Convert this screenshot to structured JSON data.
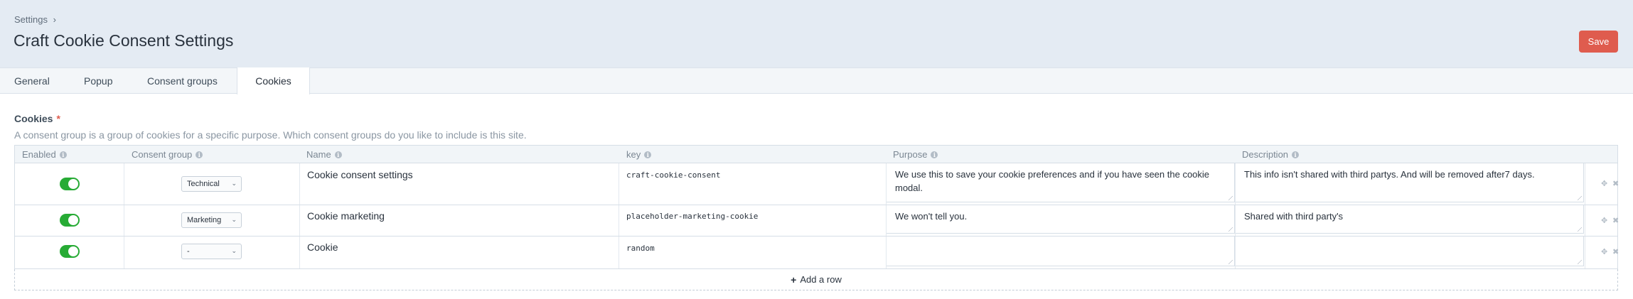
{
  "breadcrumb": {
    "label": "Settings",
    "separator": "›"
  },
  "page": {
    "title": "Craft Cookie Consent Settings",
    "save_label": "Save"
  },
  "tabs": [
    {
      "label": "General",
      "active": false
    },
    {
      "label": "Popup",
      "active": false
    },
    {
      "label": "Consent groups",
      "active": false
    },
    {
      "label": "Cookies",
      "active": true
    }
  ],
  "field": {
    "label": "Cookies",
    "required_mark": "*",
    "instructions": "A consent group is a group of cookies for a specific purpose. Which consent groups do you like to include is this site."
  },
  "table": {
    "columns": [
      "Enabled",
      "Consent group",
      "Name",
      "key",
      "Purpose",
      "Description"
    ],
    "info_glyph": "i",
    "rows": [
      {
        "enabled": true,
        "consent_group": "Technical",
        "name": "Cookie consent settings",
        "key": "craft-cookie-consent",
        "purpose": "We use this to save your cookie preferences and if you have seen the cookie modal.",
        "description": "This info isn't shared with third partys. And will be removed after7 days."
      },
      {
        "enabled": true,
        "consent_group": "Marketing",
        "name": "Cookie marketing",
        "key": "placeholder-marketing-cookie",
        "purpose": "We won't tell you.",
        "description": "Shared with third party's"
      },
      {
        "enabled": true,
        "consent_group": "-",
        "name": "Cookie",
        "key": "random",
        "purpose": "",
        "description": ""
      }
    ],
    "add_row_label": "Add a row",
    "add_row_glyph": "+",
    "move_glyph": "✥",
    "delete_glyph": "✖"
  },
  "colors": {
    "header_bg": "#e4ebf3",
    "save_button": "#df5c4e",
    "toggle_on": "#27ab35",
    "required": "#df5c4e"
  },
  "icons": {
    "move": "move-icon",
    "delete": "delete-icon",
    "info": "info-icon",
    "add": "plus-icon",
    "dropdown": "chevron-down-icon"
  }
}
